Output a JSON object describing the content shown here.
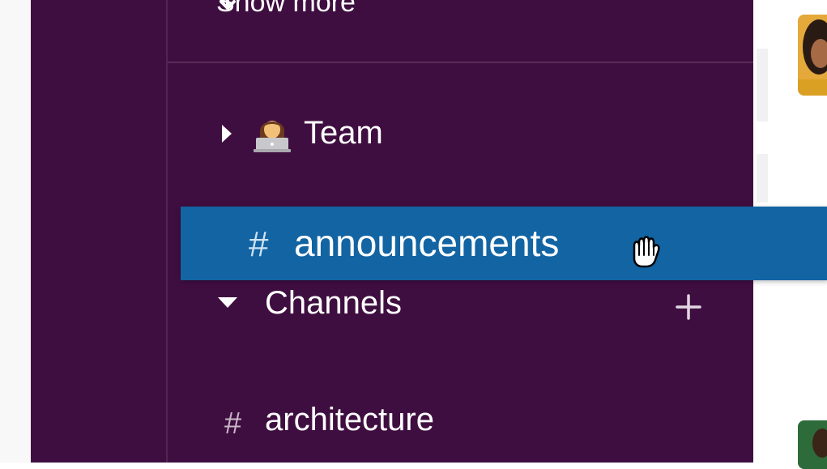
{
  "sidebar": {
    "show_more_label": "Show more",
    "sections": {
      "team": {
        "label": "Team",
        "emoji": "woman-technologist-emoji",
        "collapsed": true
      },
      "channels": {
        "label": "Channels",
        "collapsed": false
      }
    },
    "channels": [
      {
        "prefix": "#",
        "name": "architecture"
      }
    ]
  },
  "drag_item": {
    "prefix": "#",
    "name": "announcements"
  },
  "icons": {
    "show_more": "arrow-down-icon",
    "collapsed_caret": "caret-right-icon",
    "expanded_caret": "caret-down-icon",
    "add_channel": "plus-icon",
    "cursor": "grab-hand-cursor-icon"
  },
  "colors": {
    "sidebar_bg": "#3f0e40",
    "drag_highlight": "#1264a3",
    "text": "#ffffff"
  }
}
